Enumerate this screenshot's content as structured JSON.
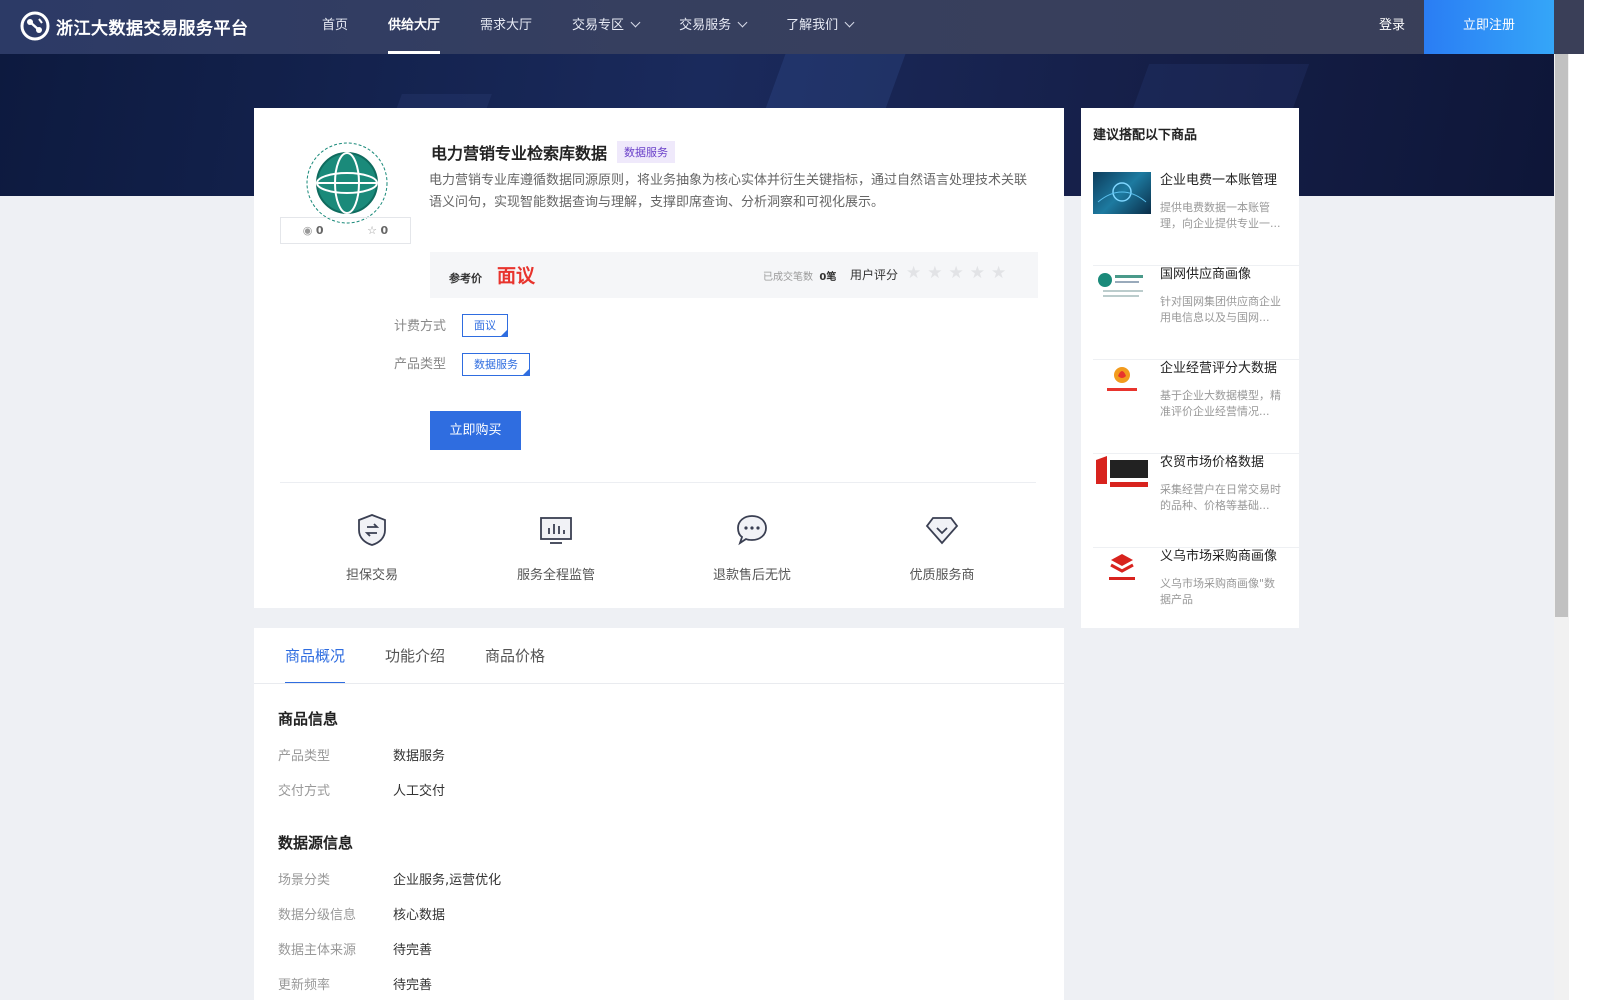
{
  "header": {
    "brand": "浙江大数据交易服务平台",
    "nav": [
      {
        "label": "首页",
        "active": false,
        "dropdown": false
      },
      {
        "label": "供给大厅",
        "active": true,
        "dropdown": false
      },
      {
        "label": "需求大厅",
        "active": false,
        "dropdown": false
      },
      {
        "label": "交易专区",
        "active": false,
        "dropdown": true
      },
      {
        "label": "交易服务",
        "active": false,
        "dropdown": true
      },
      {
        "label": "了解我们",
        "active": false,
        "dropdown": true
      }
    ],
    "login": "登录",
    "register": "立即注册"
  },
  "product": {
    "title": "电力营销专业检索库数据",
    "badge": "数据服务",
    "description": "电力营销专业库遵循数据同源原则，将业务抽象为核心实体并衍生关键指标，通过自然语言处理技术关联语义问句，实现智能数据查询与理解，支撑即席查询、分析洞察和可视化展示。",
    "views": "0",
    "favorites": "0",
    "price_label": "参考价",
    "price_value": "面议",
    "deal_count_label": "已成交笔数",
    "deal_count": "0笔",
    "rating_label": "用户评分",
    "rating": 0,
    "billing_label": "计费方式",
    "billing_value": "面议",
    "type_label": "产品类型",
    "type_value": "数据服务",
    "buy": "立即购买"
  },
  "guarantees": [
    {
      "label": "担保交易",
      "icon": "shield-exchange-icon"
    },
    {
      "label": "服务全程监管",
      "icon": "monitor-chart-icon"
    },
    {
      "label": "退款售后无忧",
      "icon": "chat-bubble-icon"
    },
    {
      "label": "优质服务商",
      "icon": "diamond-icon"
    }
  ],
  "tabs": [
    "商品概况",
    "功能介绍",
    "商品价格"
  ],
  "product_info": {
    "title": "商品信息",
    "rows": [
      {
        "label": "产品类型",
        "value": "数据服务"
      },
      {
        "label": "交付方式",
        "value": "人工交付"
      }
    ]
  },
  "source_info": {
    "title": "数据源信息",
    "rows": [
      {
        "label": "场景分类",
        "value": "企业服务,运营优化"
      },
      {
        "label": "数据分级信息",
        "value": "核心数据"
      },
      {
        "label": "数据主体来源",
        "value": "待完善"
      },
      {
        "label": "更新频率",
        "value": "待完善"
      }
    ]
  },
  "recommend": {
    "title": "建议搭配以下商品",
    "items": [
      {
        "name": "企业电费一本账管理",
        "desc": "提供电费数据一本账管理，向企业提供专业一..."
      },
      {
        "name": "国网供应商画像",
        "desc": "针对国网集团供应商企业用电信息以及与国网..."
      },
      {
        "name": "企业经营评分大数据",
        "desc": "基于企业大数据模型，精准评价企业经营情况..."
      },
      {
        "name": "农贸市场价格数据",
        "desc": "采集经营户在日常交易时的品种、价格等基础..."
      },
      {
        "name": "义乌市场采购商画像",
        "desc": "义乌市场采购商画像\"数据产品"
      }
    ]
  },
  "colors": {
    "primary": "#2f6de0",
    "price": "#e8342d",
    "nav_bg": "#363f5f"
  }
}
